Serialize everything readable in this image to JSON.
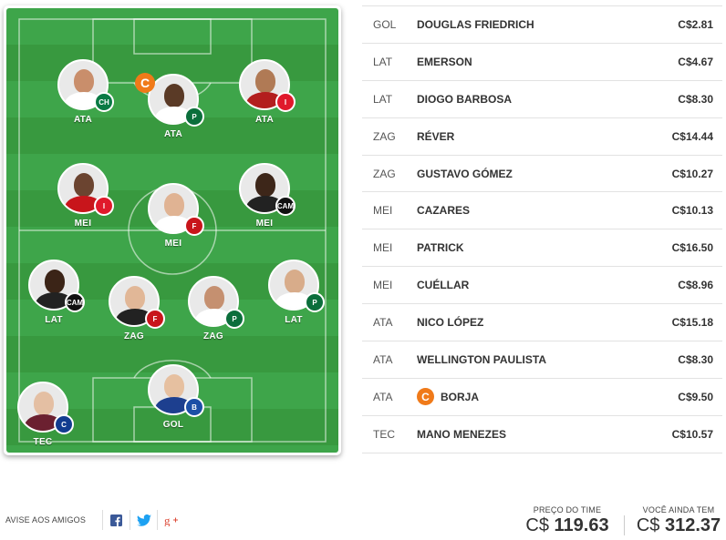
{
  "field": {
    "players": [
      {
        "pos": "ATA",
        "skin": "#c98e6b",
        "shirt": "#ffffff",
        "crest_color": "#0a7a44",
        "crest_text": "CH"
      },
      {
        "pos": "ATA",
        "skin": "#5a3a26",
        "shirt": "#ffffff",
        "crest_color": "#0b6e3b",
        "crest_text": "P",
        "captain": "C"
      },
      {
        "pos": "ATA",
        "skin": "#b07a55",
        "shirt": "#b31e1e",
        "crest_color": "#e0192b",
        "crest_text": "I"
      },
      {
        "pos": "MEI",
        "skin": "#6b4430",
        "shirt": "#c8151b",
        "crest_color": "#e0192b",
        "crest_text": "I"
      },
      {
        "pos": "MEI",
        "skin": "#e0b393",
        "shirt": "#ffffff",
        "crest_color": "#c8151b",
        "crest_text": "F"
      },
      {
        "pos": "MEI",
        "skin": "#3d2619",
        "shirt": "#222222",
        "crest_color": "#111111",
        "crest_text": "CAM"
      },
      {
        "pos": "LAT",
        "skin": "#3b2417",
        "shirt": "#222222",
        "crest_color": "#111111",
        "crest_text": "CAM"
      },
      {
        "pos": "ZAG",
        "skin": "#e1b797",
        "shirt": "#222222",
        "crest_color": "#c8151b",
        "crest_text": "F"
      },
      {
        "pos": "ZAG",
        "skin": "#c59070",
        "shirt": "#ffffff",
        "crest_color": "#0b6e3b",
        "crest_text": "P"
      },
      {
        "pos": "LAT",
        "skin": "#d8ac8a",
        "shirt": "#ffffff",
        "crest_color": "#0b6e3b",
        "crest_text": "P"
      },
      {
        "pos": "TEC",
        "skin": "#e4bfa3",
        "shirt": "#6b2030",
        "crest_color": "#123c8f",
        "crest_text": "C"
      },
      {
        "pos": "GOL",
        "skin": "#e6c0a0",
        "shirt": "#1d3f8f",
        "crest_color": "#1c4fa6",
        "crest_text": "B"
      }
    ]
  },
  "roster": [
    {
      "pos": "GOL",
      "name": "DOUGLAS FRIEDRICH",
      "price": "C$2.81"
    },
    {
      "pos": "LAT",
      "name": "EMERSON",
      "price": "C$4.67"
    },
    {
      "pos": "LAT",
      "name": "DIOGO BARBOSA",
      "price": "C$8.30"
    },
    {
      "pos": "ZAG",
      "name": "RÉVER",
      "price": "C$14.44"
    },
    {
      "pos": "ZAG",
      "name": "GUSTAVO GÓMEZ",
      "price": "C$10.27"
    },
    {
      "pos": "MEI",
      "name": "CAZARES",
      "price": "C$10.13"
    },
    {
      "pos": "MEI",
      "name": "PATRICK",
      "price": "C$16.50"
    },
    {
      "pos": "MEI",
      "name": "CUÉLLAR",
      "price": "C$8.96"
    },
    {
      "pos": "ATA",
      "name": "NICO LÓPEZ",
      "price": "C$15.18"
    },
    {
      "pos": "ATA",
      "name": "WELLINGTON PAULISTA",
      "price": "C$8.30"
    },
    {
      "pos": "ATA",
      "name": "BORJA",
      "price": "C$9.50",
      "captain": "C"
    },
    {
      "pos": "TEC",
      "name": "MANO MENEZES",
      "price": "C$10.57"
    }
  ],
  "footer": {
    "share_label": "AVISE AOS AMIGOS",
    "team_price_caption": "PREÇO DO TIME",
    "team_price_currency": "C$",
    "team_price_value": "119.63",
    "remaining_caption": "VOCÊ AINDA TEM",
    "remaining_currency": "C$",
    "remaining_value": "312.37"
  },
  "colors": {
    "captain": "#f07a19",
    "facebook": "#3b5998",
    "twitter": "#1da1f2",
    "googleplus": "#dd4b39"
  }
}
